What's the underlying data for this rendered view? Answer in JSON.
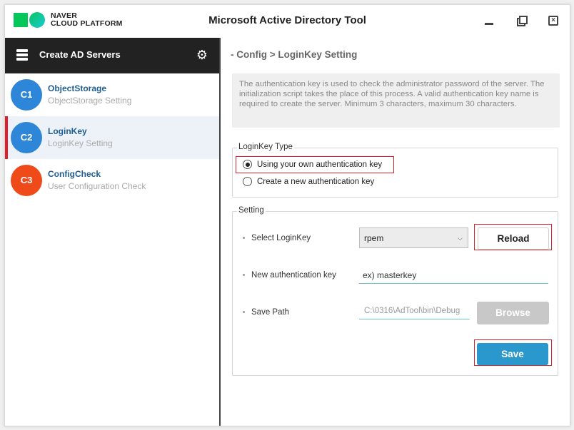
{
  "window": {
    "logo_line1": "NAVER",
    "logo_line2": "CLOUD PLATFORM",
    "title": "Microsoft Active Directory Tool",
    "controls": [
      "minimize-icon",
      "restore-icon",
      "close-icon"
    ]
  },
  "sidebar": {
    "header_label": "Create AD Servers",
    "header_icon": "servers-icon",
    "settings_icon": "gear-icon",
    "steps": [
      {
        "badge": "C1",
        "title": "ObjectStorage",
        "subtitle": "ObjectStorage Setting",
        "color": "#2e86d8",
        "active": false
      },
      {
        "badge": "C2",
        "title": "LoginKey",
        "subtitle": "LoginKey Setting",
        "color": "#2e86d8",
        "active": true
      },
      {
        "badge": "C3",
        "title": "ConfigCheck",
        "subtitle": "User Configuration Check",
        "color": "#ef4a1a",
        "active": false
      }
    ]
  },
  "main": {
    "breadcrumb": "- Config > LoginKey Setting",
    "info": "The authentication key is used to check the administrator password of the server. The initialization script takes the place of this process. A valid authentication key name is required to create the server. Minimum 3 characters, maximum 30 characters.",
    "loginkey_type": {
      "legend": "LoginKey Type",
      "options": [
        {
          "label": "Using your own authentication key",
          "selected": true
        },
        {
          "label": "Create a new authentication key",
          "selected": false
        }
      ]
    },
    "setting": {
      "legend": "Setting",
      "select_label": "Select LoginKey",
      "select_value": "rpem",
      "reload_label": "Reload",
      "new_key_label": "New authentication key",
      "new_key_value": "ex) masterkey",
      "save_path_label": "Save Path",
      "save_path_value": "C:\\0316\\AdTool\\bin\\Debug",
      "browse_label": "Browse",
      "save_label": "Save"
    }
  },
  "colors": {
    "accent": "#2b98cd",
    "highlight": "#d8232a",
    "active_marker": "#e01e2c",
    "sidebar_header": "#222222"
  }
}
